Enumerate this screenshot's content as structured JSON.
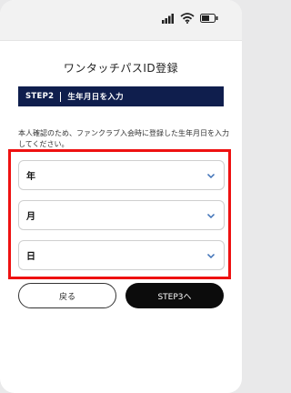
{
  "screen": {
    "title": "ワンタッチパスID登録",
    "step": {
      "number": "STEP2",
      "label": "生年月日を入力"
    },
    "instruction": "本人確認のため、ファンクラブ入会時に登録した生年月日を入力してください。",
    "fields": [
      {
        "label": "年"
      },
      {
        "label": "月"
      },
      {
        "label": "日"
      }
    ],
    "buttons": {
      "back": "戻る",
      "next": "STEP3へ"
    }
  },
  "colors": {
    "step_bar": "#0f1e4d",
    "highlight": "#ee1111",
    "chevron": "#3b6fb6",
    "primary_button": "#0c0c0c"
  },
  "icons": [
    "signal-icon",
    "wifi-icon",
    "battery-icon",
    "chevron-down-icon"
  ]
}
